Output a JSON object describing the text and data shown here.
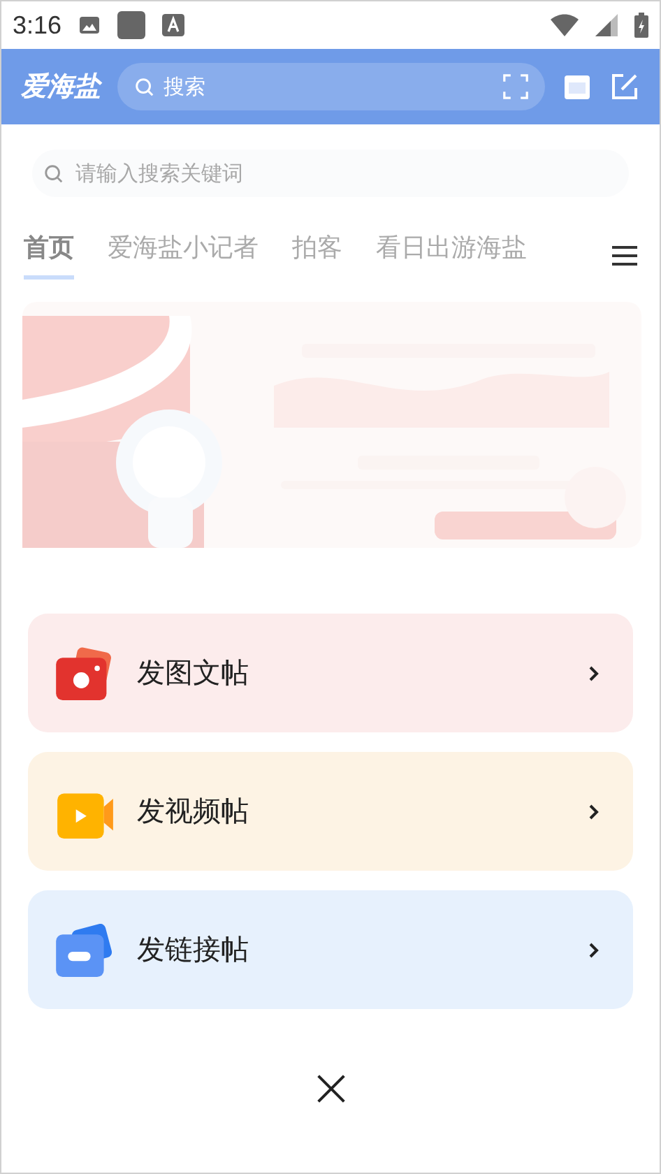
{
  "status_bar": {
    "time": "3:16"
  },
  "header": {
    "logo": "爱海盐",
    "search_placeholder": "搜索"
  },
  "search": {
    "placeholder": "请输入搜索关键词"
  },
  "tabs": [
    {
      "label": "首页",
      "selected": true
    },
    {
      "label": "爱海盐小记者",
      "selected": false
    },
    {
      "label": "拍客",
      "selected": false
    },
    {
      "label": "看日出游海盐",
      "selected": false
    }
  ],
  "actions": [
    {
      "label": "发图文帖"
    },
    {
      "label": "发视频帖",
      "kind": "video"
    },
    {
      "label": "发链接帖",
      "kind": "link"
    }
  ]
}
